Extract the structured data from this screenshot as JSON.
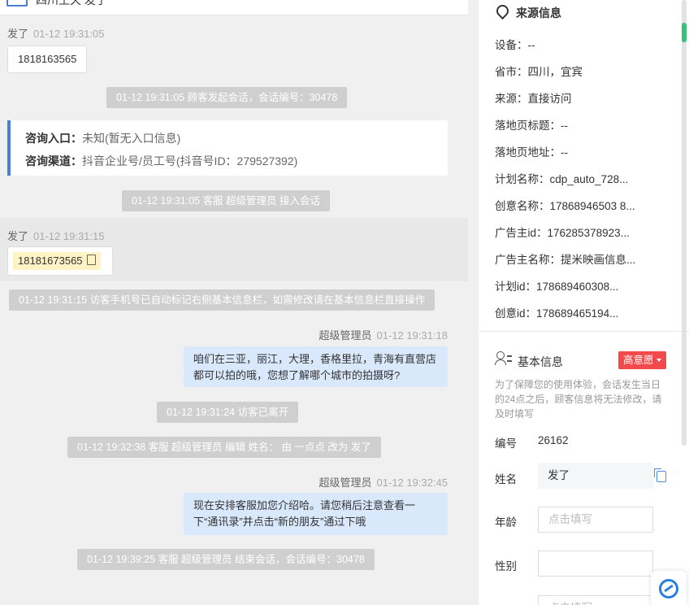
{
  "header": {
    "title": "四川王天 发了"
  },
  "chat": {
    "visitor_name": "发了",
    "msg1_time": "01-12 19:31:05",
    "msg1_text": "1818163565",
    "sys1": "01-12 19:31:05 顾客发起会话，会话编号：30478",
    "entry": {
      "label1": "咨询入口：",
      "value1": "未知(暂无入口信息)",
      "label2": "咨询渠道：",
      "value2": "抖音企业号/员工号(抖音号ID：279527392)"
    },
    "sys2": "01-12 19:31:05 客服 超级管理员 接入会话",
    "msg2_time": "01-12 19:31:15",
    "msg2_phone": "18181673565",
    "sys3": "01-12 19:31:15 访客手机号已自动标记右侧基本信息栏，如需修改请在基本信息栏直接操作",
    "agent_name": "超级管理员",
    "agent1_time": "01-12 19:31:18",
    "agent1_text": "咱们在三亚，丽江，大理，香格里拉，青海有直营店都可以拍的哦，您想了解哪个城市的拍摄呀?",
    "sys4": "01-12 19:31:24 访客已离开",
    "sys5": "01-12 19:32:38 客服 超级管理员 编辑 姓名： 由 一点点 改为 发了",
    "agent2_time": "01-12 19:32:45",
    "agent2_text": "现在安排客服加您介绍哈。请您稍后注意查看一下“通讯录”并点击“新的朋友”通过下哦",
    "sys6": "01-12 19:39:25 客服 超级管理员 结束会话，会话编号：30478"
  },
  "source": {
    "title": "来源信息",
    "items": [
      {
        "label": "设备：",
        "value": "--"
      },
      {
        "label": "省市：",
        "value": "四川，宜宾"
      },
      {
        "label": "来源：",
        "value": "直接访问"
      },
      {
        "label": "落地页标题：",
        "value": "--"
      },
      {
        "label": "落地页地址：",
        "value": "--"
      },
      {
        "label": "计划名称：",
        "value": "cdp_auto_728..."
      },
      {
        "label": "创意名称：",
        "value": "17868946503 8..."
      },
      {
        "label": "广告主id：",
        "value": "176285378923..."
      },
      {
        "label": "广告主名称：",
        "value": "提米映画信息..."
      },
      {
        "label": "计划id：",
        "value": "178689460308..."
      },
      {
        "label": "创意id：",
        "value": "178689465194..."
      }
    ]
  },
  "basic": {
    "title": "基本信息",
    "badge": "高意愿",
    "notice": "为了保障您的使用体验，会话发生当日的24点之后，顾客信息将无法修改，请及时填写",
    "id_label": "编号",
    "id_value": "26162",
    "name_label": "姓名",
    "name_value": "发了",
    "age_label": "年龄",
    "age_placeholder": "点击填写",
    "gender_label": "性别",
    "next_placeholder": "点击填写"
  },
  "colors": {
    "accent": "#4a7fd6",
    "badge": "#f24a4a",
    "agent_bubble": "#d9e8fb",
    "system": "#cfcfcf"
  }
}
